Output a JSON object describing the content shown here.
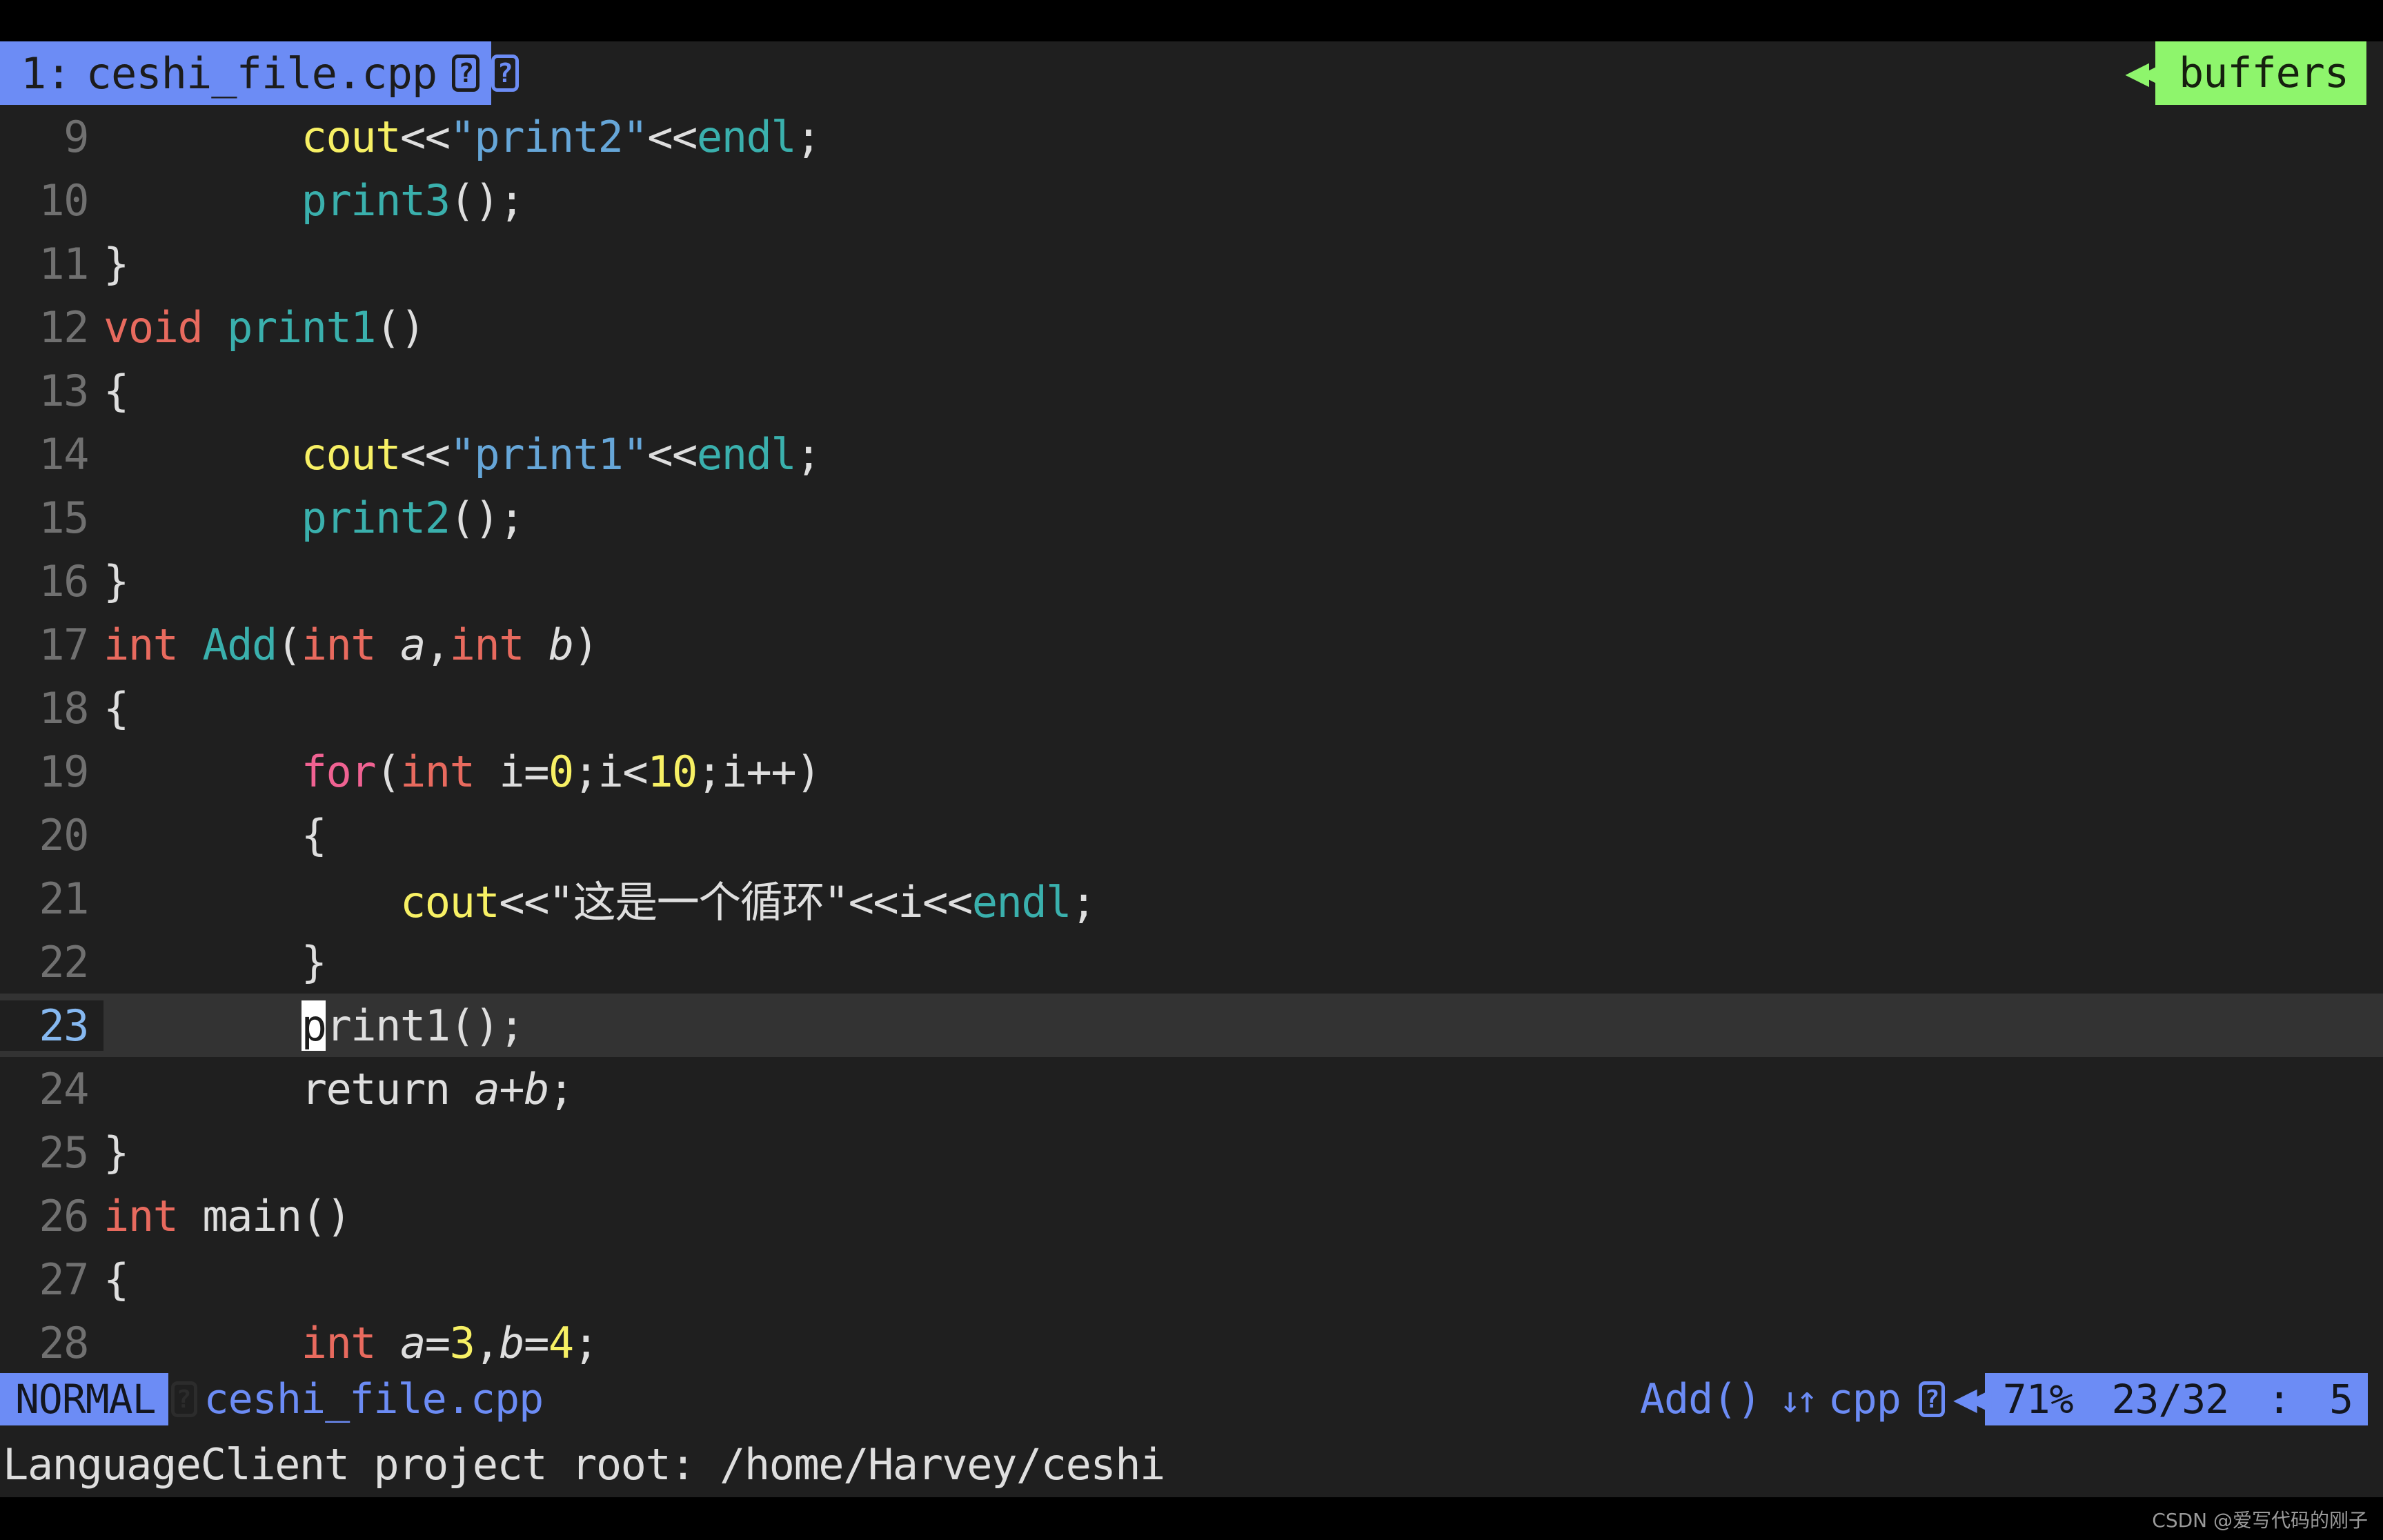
{
  "tabline": {
    "active_tab": {
      "index_label": "1:",
      "filename": "ceshi_file.cpp",
      "modified_glyph": "?",
      "type_glyph": "?"
    },
    "right": {
      "separator_icon": "arrow-left-separator",
      "buffers_label": "buffers"
    }
  },
  "editor": {
    "cursor_line": 23,
    "cursor_char": "p",
    "lines": [
      {
        "num": "9",
        "indent": 8,
        "tokens": [
          {
            "t": "cout",
            "c": "cout"
          },
          {
            "t": "plain",
            "c": "<<"
          },
          {
            "t": "str",
            "c": "\"print2\""
          },
          {
            "t": "plain",
            "c": "<<"
          },
          {
            "t": "endl",
            "c": "endl"
          },
          {
            "t": "plain",
            "c": ";"
          }
        ]
      },
      {
        "num": "10",
        "indent": 8,
        "tokens": [
          {
            "t": "fn",
            "c": "print3"
          },
          {
            "t": "plain",
            "c": "();"
          }
        ]
      },
      {
        "num": "11",
        "indent": 0,
        "tokens": [
          {
            "t": "plain",
            "c": "}"
          }
        ]
      },
      {
        "num": "12",
        "indent": 0,
        "tokens": [
          {
            "t": "kw",
            "c": "void"
          },
          {
            "t": "plain",
            "c": " "
          },
          {
            "t": "fn",
            "c": "print1"
          },
          {
            "t": "plain",
            "c": "()"
          }
        ]
      },
      {
        "num": "13",
        "indent": 0,
        "tokens": [
          {
            "t": "plain",
            "c": "{"
          }
        ]
      },
      {
        "num": "14",
        "indent": 8,
        "tokens": [
          {
            "t": "cout",
            "c": "cout"
          },
          {
            "t": "plain",
            "c": "<<"
          },
          {
            "t": "str",
            "c": "\"print1\""
          },
          {
            "t": "plain",
            "c": "<<"
          },
          {
            "t": "endl",
            "c": "endl"
          },
          {
            "t": "plain",
            "c": ";"
          }
        ]
      },
      {
        "num": "15",
        "indent": 8,
        "tokens": [
          {
            "t": "fn",
            "c": "print2"
          },
          {
            "t": "plain",
            "c": "();"
          }
        ]
      },
      {
        "num": "16",
        "indent": 0,
        "tokens": [
          {
            "t": "plain",
            "c": "}"
          }
        ]
      },
      {
        "num": "17",
        "indent": 0,
        "tokens": [
          {
            "t": "kw",
            "c": "int"
          },
          {
            "t": "plain",
            "c": " "
          },
          {
            "t": "fn",
            "c": "Add"
          },
          {
            "t": "plain",
            "c": "("
          },
          {
            "t": "kw",
            "c": "int"
          },
          {
            "t": "plain",
            "c": " "
          },
          {
            "t": "param",
            "c": "a"
          },
          {
            "t": "plain",
            "c": ","
          },
          {
            "t": "kw",
            "c": "int"
          },
          {
            "t": "plain",
            "c": " "
          },
          {
            "t": "param",
            "c": "b"
          },
          {
            "t": "plain",
            "c": ")"
          }
        ]
      },
      {
        "num": "18",
        "indent": 0,
        "tokens": [
          {
            "t": "plain",
            "c": "{"
          }
        ]
      },
      {
        "num": "19",
        "indent": 8,
        "tokens": [
          {
            "t": "ctl",
            "c": "for"
          },
          {
            "t": "plain",
            "c": "("
          },
          {
            "t": "kw",
            "c": "int"
          },
          {
            "t": "plain",
            "c": " i="
          },
          {
            "t": "num",
            "c": "0"
          },
          {
            "t": "plain",
            "c": ";i<"
          },
          {
            "t": "num",
            "c": "10"
          },
          {
            "t": "plain",
            "c": ";i++)"
          }
        ]
      },
      {
        "num": "20",
        "indent": 8,
        "tokens": [
          {
            "t": "plain",
            "c": "{"
          }
        ]
      },
      {
        "num": "21",
        "indent": 12,
        "tokens": [
          {
            "t": "cout",
            "c": "cout"
          },
          {
            "t": "plain",
            "c": "<<"
          },
          {
            "t": "strw",
            "c": "\"这是一个循环\""
          },
          {
            "t": "plain",
            "c": "<<i<<"
          },
          {
            "t": "endl",
            "c": "endl"
          },
          {
            "t": "plain",
            "c": ";"
          }
        ]
      },
      {
        "num": "22",
        "indent": 8,
        "tokens": [
          {
            "t": "plain",
            "c": "}"
          }
        ]
      },
      {
        "num": "23",
        "indent": 8,
        "current": true,
        "tokens": [
          {
            "t": "cursor",
            "c": "p"
          },
          {
            "t": "plain",
            "c": "rint1();"
          }
        ]
      },
      {
        "num": "24",
        "indent": 8,
        "tokens": [
          {
            "t": "plain",
            "c": "return "
          },
          {
            "t": "param",
            "c": "a"
          },
          {
            "t": "plain",
            "c": "+"
          },
          {
            "t": "param",
            "c": "b"
          },
          {
            "t": "plain",
            "c": ";"
          }
        ]
      },
      {
        "num": "25",
        "indent": 0,
        "tokens": [
          {
            "t": "plain",
            "c": "}"
          }
        ]
      },
      {
        "num": "26",
        "indent": 0,
        "tokens": [
          {
            "t": "kw",
            "c": "int"
          },
          {
            "t": "plain",
            "c": " main()"
          }
        ]
      },
      {
        "num": "27",
        "indent": 0,
        "tokens": [
          {
            "t": "plain",
            "c": "{"
          }
        ]
      },
      {
        "num": "28",
        "indent": 8,
        "tokens": [
          {
            "t": "kw",
            "c": "int"
          },
          {
            "t": "plain",
            "c": " "
          },
          {
            "t": "param",
            "c": "a"
          },
          {
            "t": "plain",
            "c": "="
          },
          {
            "t": "num",
            "c": "3"
          },
          {
            "t": "plain",
            "c": ","
          },
          {
            "t": "param",
            "c": "b"
          },
          {
            "t": "plain",
            "c": "="
          },
          {
            "t": "num",
            "c": "4"
          },
          {
            "t": "plain",
            "c": ";"
          }
        ]
      }
    ]
  },
  "statusline": {
    "mode": "NORMAL",
    "mode_glyph": "?",
    "filename": "ceshi_file.cpp",
    "function_context": "Add()",
    "arrows_icon": "down-up-arrows-icon",
    "filetype": "cpp",
    "filetype_glyph": "?",
    "separator_icon": "arrow-left-separator",
    "percent": "71%",
    "line_total": "23/32",
    "colon": ":",
    "column": "5"
  },
  "message": {
    "text": "LanguageClient project root: /home/Harvey/ceshi"
  },
  "watermark": {
    "text": "CSDN @爱写代码的刚子"
  },
  "colors": {
    "editor_bg": "#1f1f1f",
    "cursorline_bg": "#333333",
    "tab_active_bg": "#6c8cf5",
    "buffers_bg": "#8ef56c",
    "keyword": "#e86a5e",
    "control": "#f06292",
    "function": "#3ab0ad",
    "string": "#66a6d8",
    "number": "#f7f064",
    "plain": "#dedede",
    "linenr": "#707070",
    "cursorline_nr": "#86b8f0"
  }
}
